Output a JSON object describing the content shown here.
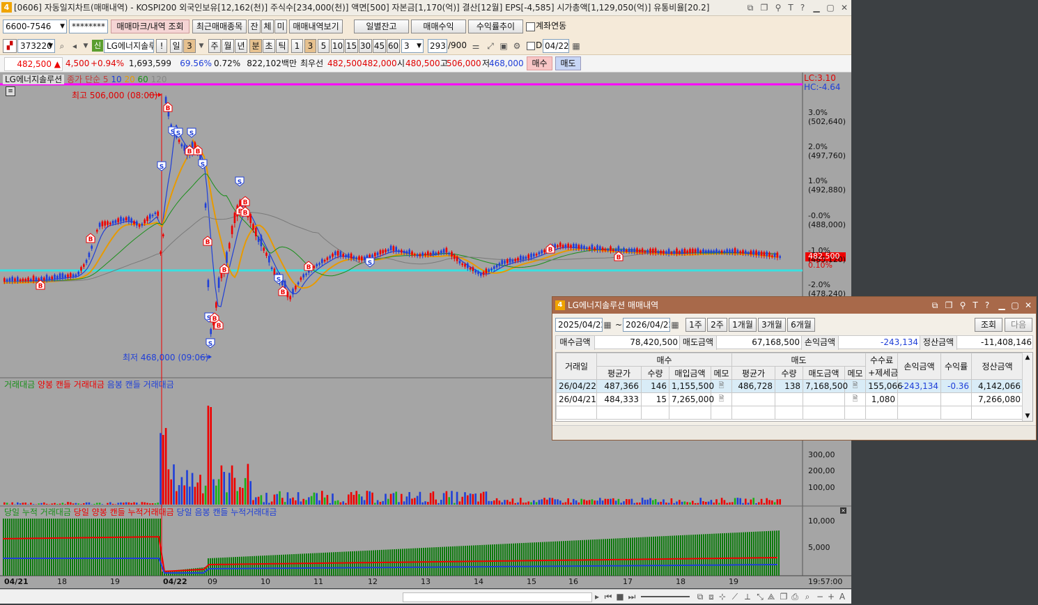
{
  "window": {
    "title": "[0606] 자동일지차트(매매내역) - KOSPI200 외국인보유[12,162(천)] 주식수[234,000(천)] 액면[500] 자본금[1,170(억)] 결산[12월] EPS[-4,585] 시가총액[1,129,050(억)] 유통비율[20.2]",
    "icon_label": "4"
  },
  "toolbar1": {
    "account": "6600-7546",
    "password": "********",
    "btn_trade_marks": "매매마크/내역 조회",
    "btn_recent_items": "최근매매종목",
    "btn_jan": "잔",
    "btn_che": "체",
    "btn_mi": "미",
    "btn_trade_view": "매매내역보기",
    "btn_daily_balance": "일별잔고",
    "btn_trade_profit": "매매수익",
    "btn_return_trend": "수익률추이",
    "account_link_label": "계좌연동"
  },
  "toolbar2": {
    "code": "373220",
    "credit_badge": "신",
    "stock_name": "LG에너지솔루",
    "warn": "!",
    "period_day": "일",
    "period_num": "3",
    "periods": [
      "주",
      "월",
      "년",
      "분",
      "초",
      "틱"
    ],
    "minutes": [
      "1",
      "3",
      "5",
      "10",
      "15",
      "30",
      "45",
      "60"
    ],
    "interval": "3",
    "count": "293",
    "max_count": "/900",
    "date_check_label": "D",
    "date": "04/22"
  },
  "quote": {
    "price": "482,500",
    "change": "4,500",
    "pct": "+0.94%",
    "volume": "1,693,599",
    "vol_ratio": "69.56%",
    "turnover": "0.72%",
    "amount": "822,102백만",
    "pref_label": "최우선",
    "ask": "482,500",
    "bid": "482,000",
    "open_label": "시",
    "open": "480,500",
    "high_label": "고",
    "high": "506,000",
    "low_label": "저",
    "low": "468,000",
    "buy_btn": "매수",
    "sell_btn": "매도"
  },
  "chart": {
    "legend_name": "LG에너지솔루션",
    "legend_ma": [
      "종가 단순 5",
      "10",
      "20",
      "60",
      "120"
    ],
    "lc": "LC:3.10",
    "hc": "HC:-4.64",
    "high_marker": "최고 506,000 (08:00)",
    "low_marker": "최저 468,000 (09:06)",
    "current_price_tag": "482,500",
    "pct_labels": [
      "3.0%",
      "2.0%",
      "1.0%",
      "-0.0%",
      "-1.0%",
      "-2.0%"
    ],
    "price_labels": [
      "(502,640)",
      "(497,760)",
      "(492,880)",
      "(488,000)",
      "(483,120)",
      "(478,240)"
    ],
    "current_pct": "0.10%",
    "volume_legend": [
      "거래대금",
      "양봉 캔들 거래대금",
      "음봉 캔들 거래대금"
    ],
    "volume_axis": [
      "300,00",
      "200,00",
      "100,00"
    ],
    "cum_legend": [
      "당일 누적 거래대금",
      "당일 양봉 캔들 누적거래대금",
      "당일 음봉 캔들 누적거래대금"
    ],
    "cum_axis": [
      "10,000",
      "5,000"
    ],
    "time_axis": [
      "04/21",
      "18",
      "19",
      "04/22",
      "09",
      "10",
      "11",
      "12",
      "13",
      "14",
      "15",
      "16",
      "17",
      "18",
      "19"
    ],
    "clock": "19:57:00"
  },
  "chart_data": {
    "type": "candlestick",
    "title": "LG에너지솔루션",
    "series": [
      {
        "name": "종가 단순 5"
      },
      {
        "name": "10"
      },
      {
        "name": "20"
      },
      {
        "name": "60"
      },
      {
        "name": "120"
      }
    ],
    "high": 506000,
    "low": 468000,
    "high_time": "08:00",
    "low_time": "09:06",
    "current": 482500,
    "x": [
      "04/21",
      "18",
      "19",
      "04/22",
      "09",
      "10",
      "11",
      "12",
      "13",
      "14",
      "15",
      "16",
      "17",
      "18",
      "19"
    ]
  },
  "popup": {
    "icon_label": "4",
    "title": "LG에너지솔루션 매매내역",
    "date_from": "2025/04/22",
    "tilde": "~",
    "date_to": "2026/04/22",
    "range_btns": [
      "1주",
      "2주",
      "1개월",
      "3개월",
      "6개월"
    ],
    "btn_search": "조회",
    "btn_next": "다음",
    "summary": {
      "buy_amt_label": "매수금액",
      "buy_amt": "78,420,500",
      "sell_amt_label": "매도금액",
      "sell_amt": "67,168,500",
      "pnl_label": "손익금액",
      "pnl": "-243,134",
      "settle_label": "정산금액",
      "settle": "-11,408,146"
    },
    "headers": {
      "date": "거래일",
      "buy": "매수",
      "sell": "매도",
      "fee1": "수수료",
      "fee2": "+제세금",
      "pnl": "손익금액",
      "ret": "수익률",
      "settle": "정산금액",
      "buy_sub": [
        "평균가",
        "수량",
        "매입금액",
        "메모"
      ],
      "sell_sub": [
        "평균가",
        "수량",
        "매도금액",
        "메모"
      ]
    },
    "rows": [
      [
        "26/04/22",
        "487,366",
        "146",
        "1,155,500",
        "",
        "486,728",
        "138",
        "7,168,500",
        "",
        "155,066",
        "-243,134",
        "-0.36",
        "4,142,066"
      ],
      [
        "26/04/21",
        "484,333",
        "15",
        "7,265,000",
        "",
        "",
        "",
        "",
        "",
        "1,080",
        "",
        "",
        "7,266,080"
      ]
    ]
  }
}
